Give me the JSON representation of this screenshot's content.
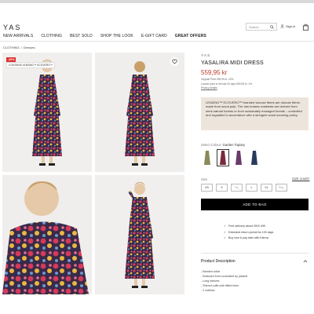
{
  "header": {
    "logo": "YAS",
    "search_placeholder": "Search",
    "signin_label": "Sign in"
  },
  "nav": {
    "items": [
      {
        "label": "NEW ARRIVALS"
      },
      {
        "label": "CLOTHING"
      },
      {
        "label": "BEST SOLD"
      },
      {
        "label": "SHOP THE LOOK"
      },
      {
        "label": "E-GIFT CARD"
      },
      {
        "label": "GREAT OFFERS"
      }
    ]
  },
  "breadcrumb": {
    "items": [
      "CLOTHING",
      "/",
      "Dresses"
    ]
  },
  "gallery": {
    "badge_sale": "-20%",
    "badge_eco": "CONTAINS LENZING™ ECOVERO™"
  },
  "product": {
    "brand": "YAS",
    "title": "YASALIRA MIDI DRESS",
    "price": "559,95 kr",
    "original_price": "Original Price 699,95 kr -20%",
    "lowest_price": "Lowest price in the last 30 days 559,95 kr -0%",
    "privacy_link": "Privacy details",
    "eco_text": "LENZING™ ECOVERO™ branded viscose fibres are viscose fibres made from wood pulp. The raw botanic materials are derived from semi-natural forests or from sustainably managed forests – controlled and regulated in accordance with a stringent wood sourcing policy.",
    "colour_label": "Select Colour:",
    "colour_value": "Garden Topiary",
    "size_label": "Size",
    "size_chart": "SIZE CHART",
    "sizes": [
      {
        "label": "XS",
        "available": true
      },
      {
        "label": "S",
        "available": true
      },
      {
        "label": "M",
        "available": false
      },
      {
        "label": "L",
        "available": true
      },
      {
        "label": "XL",
        "available": true
      },
      {
        "label": "XXL",
        "available": false
      }
    ],
    "add_to_bag": "ADD TO BAG",
    "usps": [
      "Free delivery above DKK 499",
      "Extended return period for 100 days",
      "Buy now & pay later with Klarna"
    ],
    "description_title": "Product Description",
    "description_items": [
      "- Banded collar",
      "- Buttoned front concealed by placket",
      "- Long sleeves",
      "- Shirred cuffs with frilled trims",
      "- 2 cutlines"
    ]
  },
  "colors": {
    "sale": "#e03030",
    "price": "#c0392b",
    "eco_box": "#ede5dc",
    "button": "#000000"
  }
}
